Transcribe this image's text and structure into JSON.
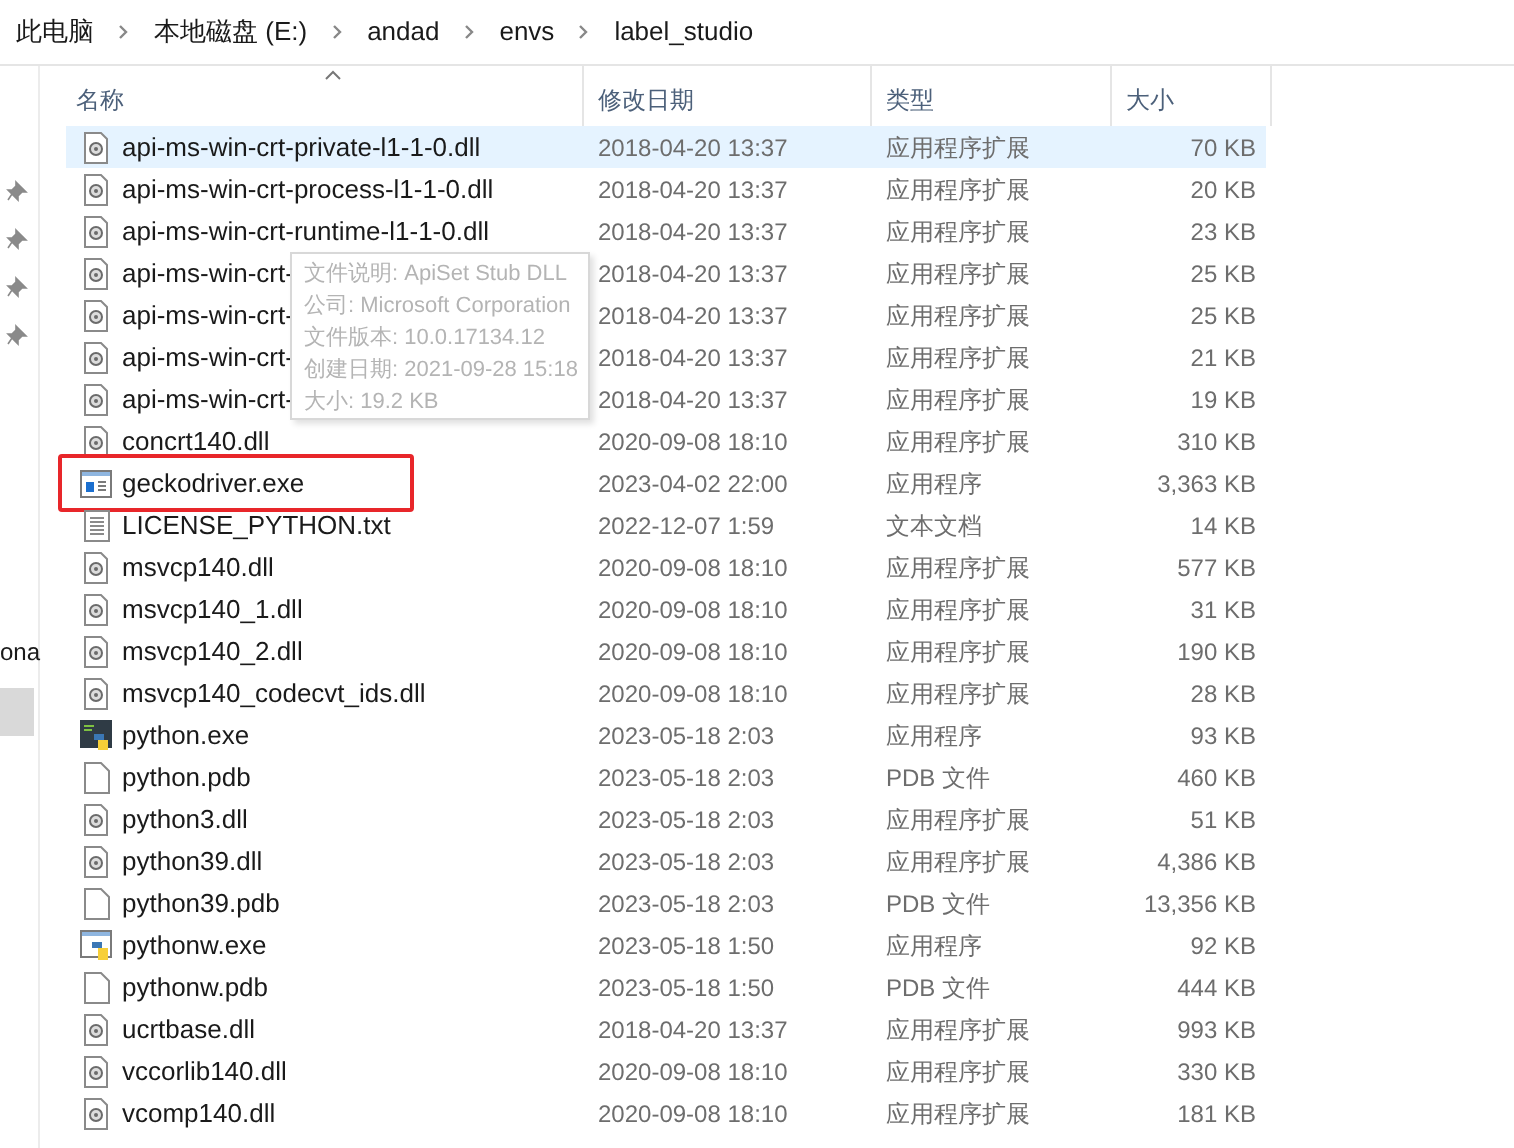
{
  "breadcrumb": [
    "此电脑",
    "本地磁盘 (E:)",
    "andad",
    "envs",
    "label_studio"
  ],
  "navigation_pane": {
    "item_fragment": "ona"
  },
  "columns": [
    {
      "label": "名称",
      "sorted": true
    },
    {
      "label": "修改日期",
      "sorted": false
    },
    {
      "label": "类型",
      "sorted": false
    },
    {
      "label": "大小",
      "sorted": false
    }
  ],
  "rows": [
    {
      "name": "api-ms-win-crt-private-l1-1-0.dll",
      "kind": "dll",
      "modified": "2018-04-20 13:37",
      "type": "应用程序扩展",
      "size": "70 KB",
      "hovered": true,
      "annotated": false
    },
    {
      "name": "api-ms-win-crt-process-l1-1-0.dll",
      "kind": "dll",
      "modified": "2018-04-20 13:37",
      "type": "应用程序扩展",
      "size": "20 KB",
      "hovered": false,
      "annotated": false
    },
    {
      "name": "api-ms-win-crt-runtime-l1-1-0.dll",
      "kind": "dll",
      "modified": "2018-04-20 13:37",
      "type": "应用程序扩展",
      "size": "23 KB",
      "hovered": false,
      "annotated": false
    },
    {
      "name": "api-ms-win-crt-",
      "kind": "dll",
      "modified": "2018-04-20 13:37",
      "type": "应用程序扩展",
      "size": "25 KB",
      "hovered": false,
      "annotated": false
    },
    {
      "name": "api-ms-win-crt-",
      "kind": "dll",
      "modified": "2018-04-20 13:37",
      "type": "应用程序扩展",
      "size": "25 KB",
      "hovered": false,
      "annotated": false
    },
    {
      "name": "api-ms-win-crt-",
      "kind": "dll",
      "modified": "2018-04-20 13:37",
      "type": "应用程序扩展",
      "size": "21 KB",
      "hovered": false,
      "annotated": false
    },
    {
      "name": "api-ms-win-crt-",
      "kind": "dll",
      "modified": "2018-04-20 13:37",
      "type": "应用程序扩展",
      "size": "19 KB",
      "hovered": false,
      "annotated": false
    },
    {
      "name": "concrt140.dll",
      "kind": "dll",
      "modified": "2020-09-08 18:10",
      "type": "应用程序扩展",
      "size": "310 KB",
      "hovered": false,
      "annotated": false
    },
    {
      "name": "geckodriver.exe",
      "kind": "exe",
      "modified": "2023-04-02 22:00",
      "type": "应用程序",
      "size": "3,363 KB",
      "hovered": false,
      "annotated": true
    },
    {
      "name": "LICENSE_PYTHON.txt",
      "kind": "txt",
      "modified": "2022-12-07 1:59",
      "type": "文本文档",
      "size": "14 KB",
      "hovered": false,
      "annotated": false
    },
    {
      "name": "msvcp140.dll",
      "kind": "dll",
      "modified": "2020-09-08 18:10",
      "type": "应用程序扩展",
      "size": "577 KB",
      "hovered": false,
      "annotated": false
    },
    {
      "name": "msvcp140_1.dll",
      "kind": "dll",
      "modified": "2020-09-08 18:10",
      "type": "应用程序扩展",
      "size": "31 KB",
      "hovered": false,
      "annotated": false
    },
    {
      "name": "msvcp140_2.dll",
      "kind": "dll",
      "modified": "2020-09-08 18:10",
      "type": "应用程序扩展",
      "size": "190 KB",
      "hovered": false,
      "annotated": false
    },
    {
      "name": "msvcp140_codecvt_ids.dll",
      "kind": "dll",
      "modified": "2020-09-08 18:10",
      "type": "应用程序扩展",
      "size": "28 KB",
      "hovered": false,
      "annotated": false
    },
    {
      "name": "python.exe",
      "kind": "python",
      "modified": "2023-05-18 2:03",
      "type": "应用程序",
      "size": "93 KB",
      "hovered": false,
      "annotated": false
    },
    {
      "name": "python.pdb",
      "kind": "pdb",
      "modified": "2023-05-18 2:03",
      "type": "PDB 文件",
      "size": "460 KB",
      "hovered": false,
      "annotated": false
    },
    {
      "name": "python3.dll",
      "kind": "dll",
      "modified": "2023-05-18 2:03",
      "type": "应用程序扩展",
      "size": "51 KB",
      "hovered": false,
      "annotated": false
    },
    {
      "name": "python39.dll",
      "kind": "dll",
      "modified": "2023-05-18 2:03",
      "type": "应用程序扩展",
      "size": "4,386 KB",
      "hovered": false,
      "annotated": false
    },
    {
      "name": "python39.pdb",
      "kind": "pdb",
      "modified": "2023-05-18 2:03",
      "type": "PDB 文件",
      "size": "13,356 KB",
      "hovered": false,
      "annotated": false
    },
    {
      "name": "pythonw.exe",
      "kind": "pythonw",
      "modified": "2023-05-18 1:50",
      "type": "应用程序",
      "size": "92 KB",
      "hovered": false,
      "annotated": false
    },
    {
      "name": "pythonw.pdb",
      "kind": "pdb",
      "modified": "2023-05-18 1:50",
      "type": "PDB 文件",
      "size": "444 KB",
      "hovered": false,
      "annotated": false
    },
    {
      "name": "ucrtbase.dll",
      "kind": "dll",
      "modified": "2018-04-20 13:37",
      "type": "应用程序扩展",
      "size": "993 KB",
      "hovered": false,
      "annotated": false
    },
    {
      "name": "vccorlib140.dll",
      "kind": "dll",
      "modified": "2020-09-08 18:10",
      "type": "应用程序扩展",
      "size": "330 KB",
      "hovered": false,
      "annotated": false
    },
    {
      "name": "vcomp140.dll",
      "kind": "dll",
      "modified": "2020-09-08 18:10",
      "type": "应用程序扩展",
      "size": "181 KB",
      "hovered": false,
      "annotated": false
    }
  ],
  "tooltip": {
    "lines": [
      "文件说明: ApiSet Stub DLL",
      "公司: Microsoft Corporation",
      "文件版本: 10.0.17134.12",
      "创建日期: 2021-09-28 15:18",
      "大小: 19.2 KB"
    ]
  }
}
